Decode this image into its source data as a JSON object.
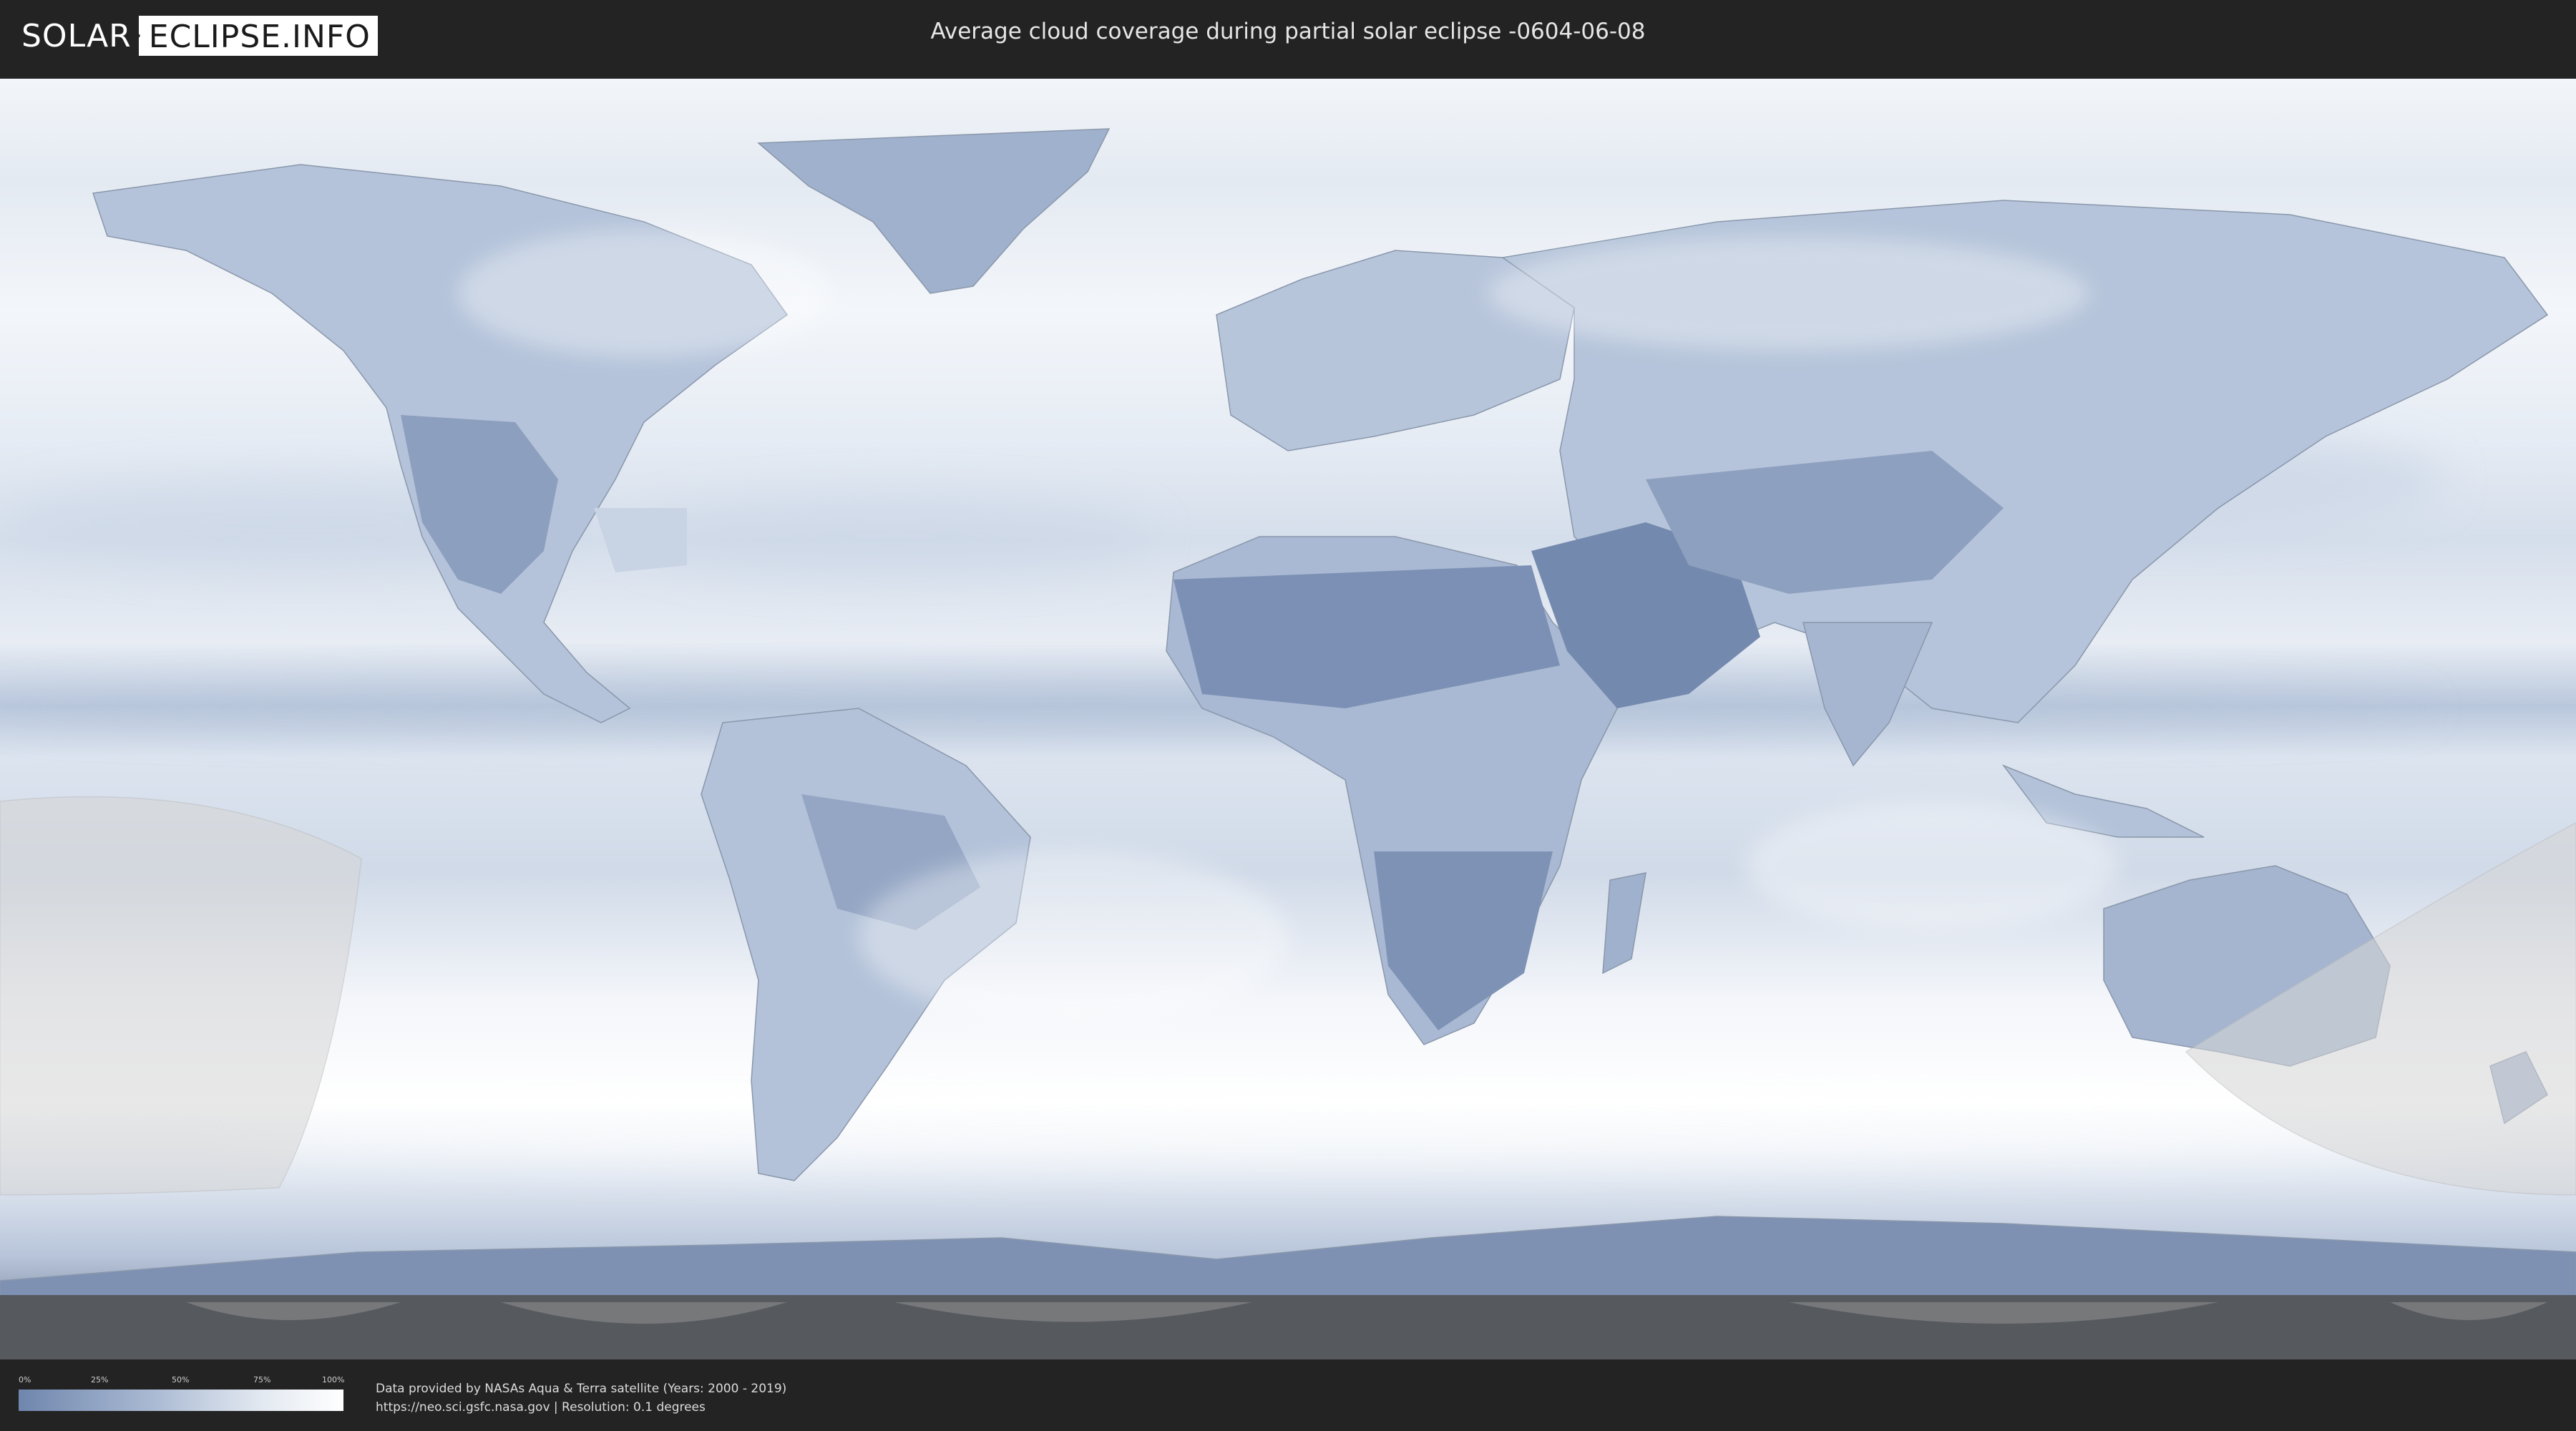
{
  "header": {
    "logo_part1": "SOLAR",
    "logo_part2": "ECLIPSE.INFO",
    "title": "Average cloud coverage during partial solar eclipse -0604-06-08"
  },
  "legend": {
    "ticks": [
      "0%",
      "25%",
      "50%",
      "75%",
      "100%"
    ],
    "gradient_colors": [
      "#6f86ad",
      "#a8b8d2",
      "#e3e9f1",
      "#ffffff"
    ]
  },
  "footer": {
    "credit_line1": "Data provided by NASAs Aqua & Terra satellite (Years: 2000 - 2019)",
    "credit_line2": "https://neo.sci.gsfc.nasa.gov | Resolution: 0.1 degrees"
  },
  "colors": {
    "background": "#232323",
    "map_frame": "#4a4a4a",
    "clear_sky": "#6f86ad",
    "cloudy": "#ffffff",
    "eclipse_zone": "#d8d8d8"
  },
  "map": {
    "icons": [
      "world-map",
      "eclipse-visibility-zone"
    ]
  }
}
